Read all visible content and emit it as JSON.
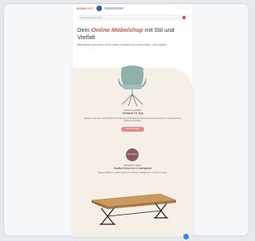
{
  "email": {
    "brand": "MÖBELFIT",
    "search_placeholder": "Wonach suchst du?",
    "headline_prefix": "Dein ",
    "headline_accent": "Online Möbelshop",
    "headline_suffix": " mit Stil und Vielfalt",
    "intro_text": "Möbel bequem online kaufen: bei Dir zuhause, hochwertig und zu fairen Preisen – jetzt entdecken.",
    "product1": {
      "category": "Esszimmerstühle",
      "name": "Drehstuhl Gil, Bog",
      "description": "Elegant und bequem: Der Drehstuhl mit Stoffbezug und Metallgestell passt perfekt an jeden Esstisch. Entdecke weitere Varianten und Farben.",
      "cta_label": "Jetzt entdecken"
    },
    "badge_label": "Bestseller",
    "product2": {
      "category": "Esstische massiv",
      "name": "Esstisch Eiche mit X-Kufengestell",
      "description": "Massive Wildeiche, natürlich geölt, mit schwarzem Metallgestell in modernem Design.",
      "cta_label": "Zum Produkt"
    }
  },
  "colors": {
    "accent": "#c05a52",
    "cta": "#e58a83",
    "blob": "#f6efe7"
  },
  "icons": [
    "search-icon",
    "chair-image",
    "table-image",
    "account-icon",
    "cart-icon"
  ]
}
